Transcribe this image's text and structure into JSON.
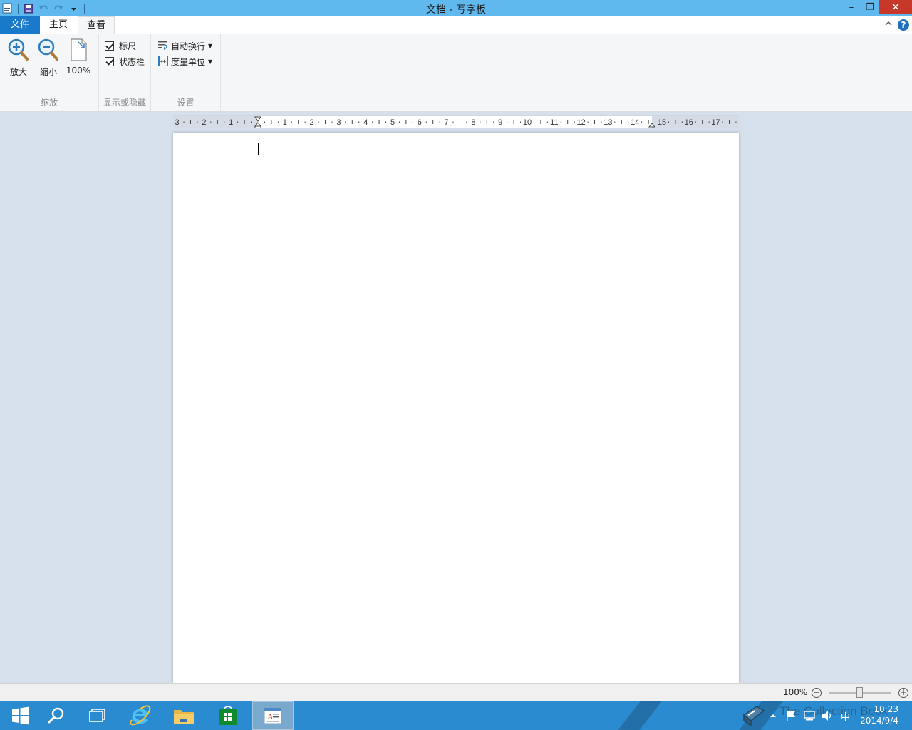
{
  "window": {
    "title": "文档 - 写字板",
    "minimize": "–",
    "restore": "❐",
    "close": "✕"
  },
  "ribbon": {
    "tabs": {
      "file": "文件",
      "home": "主页",
      "view": "查看"
    },
    "help": "?",
    "groups": {
      "zoom": {
        "label": "缩放",
        "zoom_in": "放大",
        "zoom_out": "缩小",
        "reset": "100%"
      },
      "show_hide": {
        "label": "显示或隐藏",
        "ruler": "标尺",
        "status_bar": "状态栏",
        "ruler_checked": true,
        "status_bar_checked": true
      },
      "settings": {
        "label": "设置",
        "word_wrap": "自动换行",
        "measurement_units": "度量单位"
      }
    }
  },
  "ruler": {
    "left_labels": [
      "3",
      "2",
      "1"
    ],
    "right_labels": [
      "1",
      "2",
      "3",
      "4",
      "5",
      "6",
      "7",
      "8",
      "9",
      "10",
      "11",
      "12",
      "13",
      "14",
      "15",
      "16",
      "17"
    ]
  },
  "statusbar": {
    "zoom_level": "100%",
    "zoom_out": "−",
    "zoom_in": "+",
    "zoom_slider_value": 0.5
  },
  "taskbar": {
    "time": "10:23",
    "date": "2014/9/4",
    "ime": "中",
    "watermark": "The Collection Book"
  },
  "colors": {
    "titlebar": "#5fb8ee",
    "file_tab": "#1979ca",
    "taskbar": "#2b8bd0",
    "close_button": "#c7372a"
  }
}
